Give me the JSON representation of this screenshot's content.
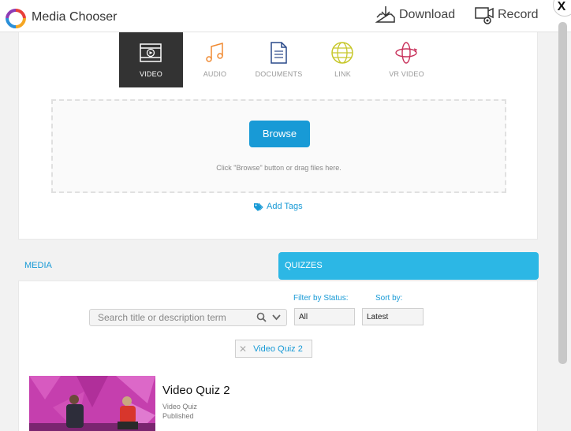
{
  "header": {
    "title": "Media Chooser",
    "download_label": "Download",
    "record_label": "Record",
    "close_label": "X"
  },
  "media_tabs": [
    {
      "label": "VIDEO",
      "icon": "video-icon",
      "active": true
    },
    {
      "label": "AUDIO",
      "icon": "music-icon",
      "active": false
    },
    {
      "label": "DOCUMENTS",
      "icon": "document-icon",
      "active": false
    },
    {
      "label": "LINK",
      "icon": "globe-icon",
      "active": false
    },
    {
      "label": "VR VIDEO",
      "icon": "vr-icon",
      "active": false
    }
  ],
  "upload": {
    "browse_label": "Browse",
    "hint": "Click \"Browse\" button or drag files here.",
    "add_tags_label": "Add Tags"
  },
  "tabs": {
    "media": "MEDIA",
    "quizzes": "QUIZZES"
  },
  "filters": {
    "search_placeholder": "Search title or description term",
    "status_label": "Filter by Status:",
    "status_value": "All",
    "sort_label": "Sort by:",
    "sort_value": "Latest",
    "active_chip": "Video Quiz 2"
  },
  "item": {
    "title": "Video Quiz 2",
    "type": "Video Quiz",
    "status": "Published"
  },
  "colors": {
    "accent": "#189ad6",
    "quizzes_tab": "#2cb7e5",
    "active_tab": "#333333"
  }
}
